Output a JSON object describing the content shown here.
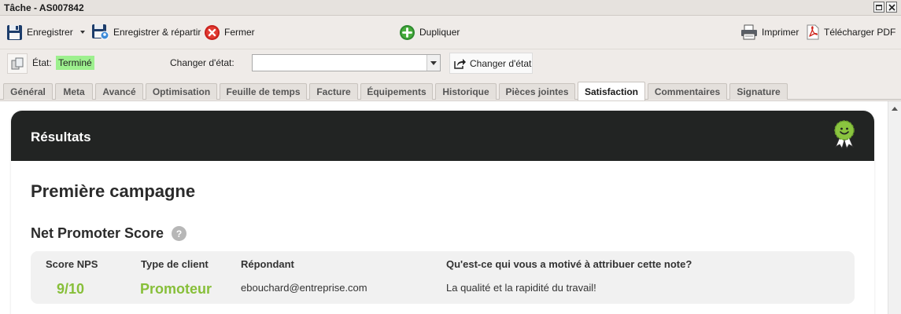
{
  "window": {
    "title": "Tâche - AS007842"
  },
  "toolbar": {
    "save": "Enregistrer",
    "save_dispatch": "Enregistrer & répartir",
    "close": "Fermer",
    "duplicate": "Dupliquer",
    "print": "Imprimer",
    "pdf": "Télécharger PDF"
  },
  "status": {
    "label": "État:",
    "value": "Terminé",
    "value_color": "#9df08e",
    "change_label": "Changer d'état:",
    "select_value": "",
    "change_button": "Changer d'état"
  },
  "tabs": [
    "Général",
    "Meta",
    "Avancé",
    "Optimisation",
    "Feuille de temps",
    "Facture",
    "Équipements",
    "Historique",
    "Pièces jointes",
    "Satisfaction",
    "Commentaires",
    "Signature"
  ],
  "active_tab": "Satisfaction",
  "results": {
    "header": "Résultats",
    "header_color": "#222423",
    "campaign": "Première campagne",
    "nps_title": "Net Promoter Score",
    "help": "?",
    "columns": {
      "score": "Score NPS",
      "client_type": "Type de client",
      "respondent": "Répondant",
      "question": "Qu'est-ce qui vous a motivé à attribuer cette note?"
    },
    "row": {
      "score": "9/10",
      "client_type": "Promoteur",
      "respondent": "ebouchard@entreprise.com",
      "answer": "La qualité et la rapidité du travail!"
    },
    "accent_color": "#87bf39"
  },
  "icons": {
    "save": "floppy-disk-icon",
    "save_dispatch": "floppy-user-icon",
    "close": "red-x-circle-icon",
    "duplicate": "green-plus-circle-icon",
    "print": "printer-icon",
    "pdf": "pdf-icon",
    "status": "copy-state-icon",
    "change_state": "share-arrow-icon",
    "satisfaction": "smiley-award-icon"
  }
}
